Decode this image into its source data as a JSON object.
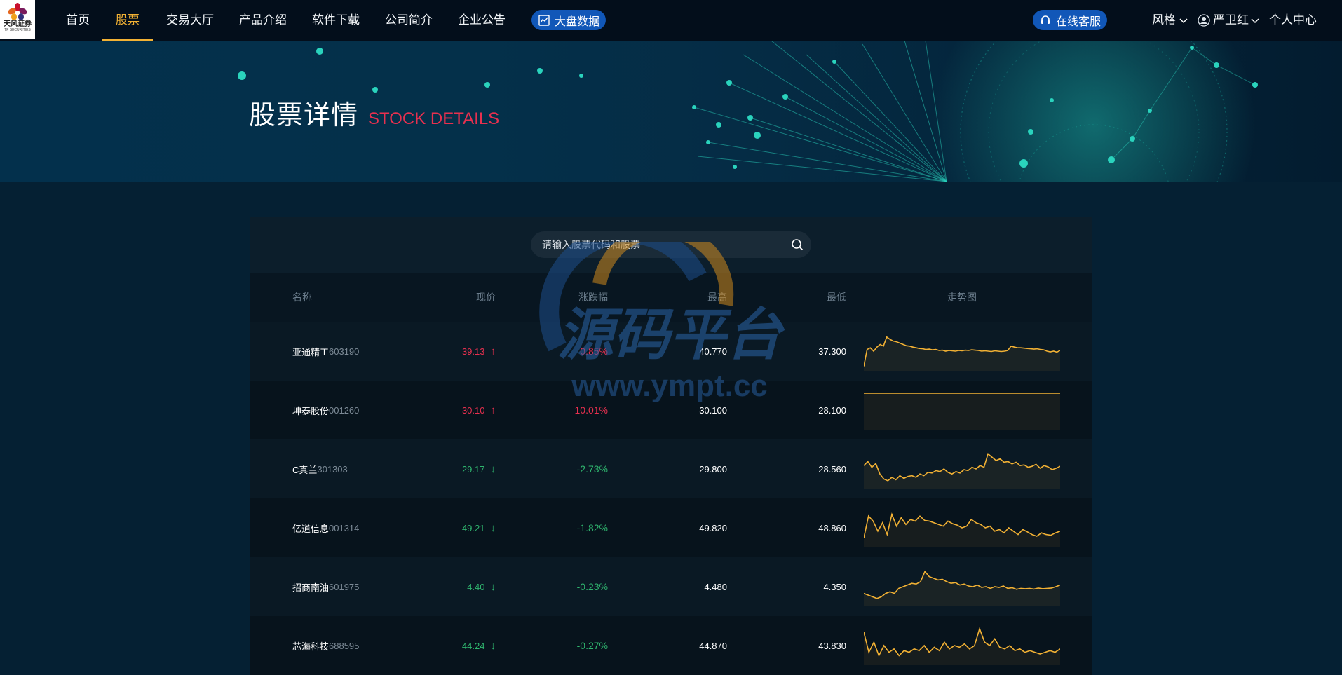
{
  "logo": {
    "name": "天风证券",
    "sub": "TF SECURITIES"
  },
  "nav": {
    "items": [
      {
        "label": "首页"
      },
      {
        "label": "股票"
      },
      {
        "label": "交易大厅"
      },
      {
        "label": "产品介绍"
      },
      {
        "label": "软件下载"
      },
      {
        "label": "公司简介"
      },
      {
        "label": "企业公告"
      }
    ],
    "active_index": 1,
    "market_button": {
      "label": "大盘数据",
      "icon": "chart-line-icon"
    },
    "service_button": {
      "label": "在线客服",
      "icon": "headset-icon"
    },
    "style_menu": {
      "label": "风格",
      "icon": "chevron-down-icon"
    },
    "user_menu": {
      "label": "严卫红",
      "icon": "user-avatar-icon"
    },
    "profile_link": {
      "label": "个人中心"
    }
  },
  "banner": {
    "title_cn": "股票详情",
    "title_en": "STOCK DETAILS"
  },
  "search": {
    "placeholder": "请输入股票代码和股票",
    "icon": "search-icon"
  },
  "table": {
    "headers": {
      "name": "名称",
      "price": "现价",
      "change": "涨跌幅",
      "high": "最高",
      "low": "最低",
      "trend": "走势图"
    },
    "rows": [
      {
        "name": "亚通精工",
        "code": "603190",
        "price": "39.13",
        "dir": "up",
        "change": "0.85%",
        "high": "40.770",
        "low": "37.300",
        "trend": [
          0.05,
          0.55,
          0.6,
          0.5,
          0.62,
          0.7,
          0.65,
          0.92,
          0.85,
          0.8,
          0.78,
          0.74,
          0.7,
          0.66,
          0.65,
          0.62,
          0.6,
          0.58,
          0.57,
          0.55,
          0.56,
          0.54,
          0.55,
          0.52,
          0.53,
          0.5,
          0.52,
          0.51,
          0.5,
          0.52,
          0.51,
          0.53,
          0.52,
          0.54,
          0.53,
          0.52,
          0.5,
          0.51,
          0.5,
          0.49,
          0.51,
          0.5,
          0.49,
          0.5,
          0.52,
          0.65,
          0.62,
          0.6,
          0.6,
          0.59,
          0.58,
          0.57,
          0.56,
          0.57,
          0.55,
          0.54,
          0.5,
          0.48,
          0.5,
          0.47,
          0.52
        ]
      },
      {
        "name": "坤泰股份",
        "code": "001260",
        "price": "30.10",
        "dir": "up",
        "change": "10.01%",
        "high": "30.100",
        "low": "28.100",
        "trend": [
          1,
          1,
          1,
          1,
          1,
          1,
          1,
          1,
          1,
          1
        ]
      },
      {
        "name": "C真兰",
        "code": "301303",
        "price": "29.17",
        "dir": "down",
        "change": "-2.73%",
        "high": "29.800",
        "low": "28.560",
        "trend": [
          0.6,
          0.72,
          0.55,
          0.66,
          0.35,
          0.2,
          0.15,
          0.25,
          0.18,
          0.3,
          0.22,
          0.28,
          0.3,
          0.25,
          0.35,
          0.3,
          0.4,
          0.38,
          0.45,
          0.42,
          0.5,
          0.4,
          0.35,
          0.42,
          0.38,
          0.48,
          0.45,
          0.55,
          0.5,
          0.6,
          0.55,
          0.95,
          0.85,
          0.75,
          0.8,
          0.7,
          0.72,
          0.65,
          0.7,
          0.6,
          0.62,
          0.55,
          0.58,
          0.64,
          0.52,
          0.6,
          0.56,
          0.48,
          0.52,
          0.58
        ]
      },
      {
        "name": "亿道信息",
        "code": "001314",
        "price": "49.21",
        "dir": "down",
        "change": "-1.82%",
        "high": "49.820",
        "low": "48.860",
        "trend": [
          0.2,
          0.85,
          0.7,
          0.4,
          0.65,
          0.3,
          0.9,
          0.55,
          0.8,
          0.6,
          0.75,
          0.7,
          0.85,
          0.72,
          0.7,
          0.65,
          0.6,
          0.55,
          0.7,
          0.62,
          0.58,
          0.5,
          0.55,
          0.75,
          0.65,
          0.6,
          0.5,
          0.55,
          0.4,
          0.45,
          0.35,
          0.5,
          0.4,
          0.3,
          0.45,
          0.38,
          0.3,
          0.25,
          0.35,
          0.3,
          0.28,
          0.35,
          0.4
        ]
      },
      {
        "name": "招商南油",
        "code": "601975",
        "price": "4.40",
        "dir": "down",
        "change": "-0.23%",
        "high": "4.480",
        "low": "4.350",
        "trend": [
          0.3,
          0.25,
          0.2,
          0.15,
          0.2,
          0.3,
          0.35,
          0.3,
          0.45,
          0.5,
          0.55,
          0.6,
          0.58,
          0.65,
          0.95,
          0.8,
          0.75,
          0.7,
          0.72,
          0.65,
          0.6,
          0.62,
          0.55,
          0.58,
          0.52,
          0.5,
          0.55,
          0.48,
          0.5,
          0.45,
          0.5,
          0.48,
          0.52,
          0.45,
          0.47,
          0.42,
          0.45,
          0.44,
          0.45,
          0.43,
          0.46,
          0.44,
          0.45,
          0.46,
          0.5,
          0.55
        ]
      },
      {
        "name": "芯海科技",
        "code": "688595",
        "price": "44.24",
        "dir": "down",
        "change": "-0.27%",
        "high": "44.870",
        "low": "43.830",
        "trend": [
          0.9,
          0.3,
          0.6,
          0.2,
          0.5,
          0.3,
          0.4,
          0.2,
          0.35,
          0.3,
          0.4,
          0.35,
          0.5,
          0.3,
          0.45,
          0.35,
          0.6,
          0.4,
          0.5,
          0.45,
          0.55,
          0.4,
          0.5,
          1,
          0.6,
          0.5,
          0.7,
          0.45,
          0.4,
          0.5,
          0.35,
          0.4,
          0.3,
          0.35,
          0.3,
          0.25,
          0.3,
          0.35,
          0.3,
          0.4
        ]
      }
    ]
  },
  "watermark": {
    "brand": "源码平台",
    "url": "www.ympt.cc"
  },
  "colors": {
    "accent": "#f2b134",
    "up": "#e8304f",
    "down": "#2fb56e",
    "pill": "#1157b8"
  }
}
